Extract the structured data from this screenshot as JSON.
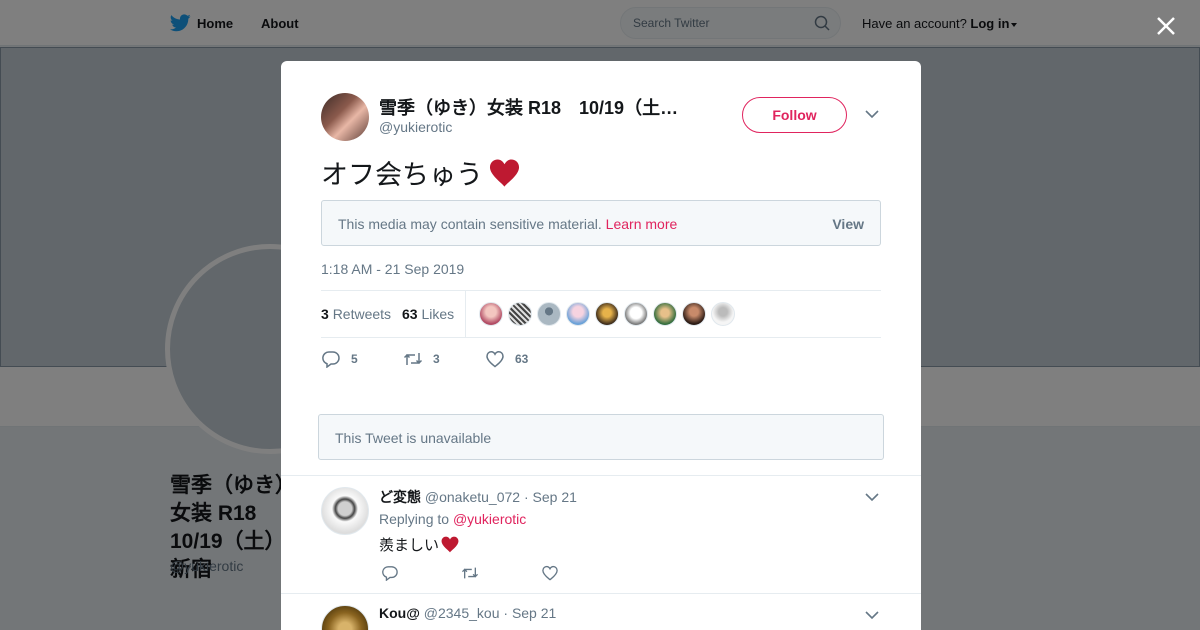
{
  "topbar": {
    "home_label": "Home",
    "about_label": "About",
    "search_placeholder": "Search Twitter",
    "account_prompt": "Have an account?",
    "login_label": "Log in"
  },
  "profile": {
    "name": "雪季（ゆき）女装 R18　10/19（土）新宿",
    "handle": "@yukierotic"
  },
  "tweet": {
    "author_name": "雪季（ゆき）女装 R18　10/19（土）新宿",
    "author_handle": "@yukierotic",
    "follow_label": "Follow",
    "text": "オフ会ちゅう",
    "sensitive_notice": "This media may contain sensitive material.",
    "learn_more": "Learn more",
    "view_label": "View",
    "timestamp": "1:18 AM - 21 Sep 2019",
    "retweets_count": "3",
    "retweets_label": "Retweets",
    "likes_count": "63",
    "likes_label": "Likes",
    "actions": {
      "replies": "5",
      "retweets": "3",
      "likes": "63"
    },
    "unavailable_text": "This Tweet is unavailable"
  },
  "replies": [
    {
      "name": "ど変態",
      "handle": "@onaketu_072",
      "date": "Sep 21",
      "replying_prefix": "Replying to",
      "replying_to": "@yukierotic",
      "text": "羨ましい"
    },
    {
      "name": "Kou@",
      "handle": "@2345_kou",
      "date": "Sep 21"
    }
  ],
  "colors": {
    "accent": "#e0245e",
    "heart": "#be1931",
    "twitter_blue": "#1da1f2",
    "muted": "#657786"
  }
}
